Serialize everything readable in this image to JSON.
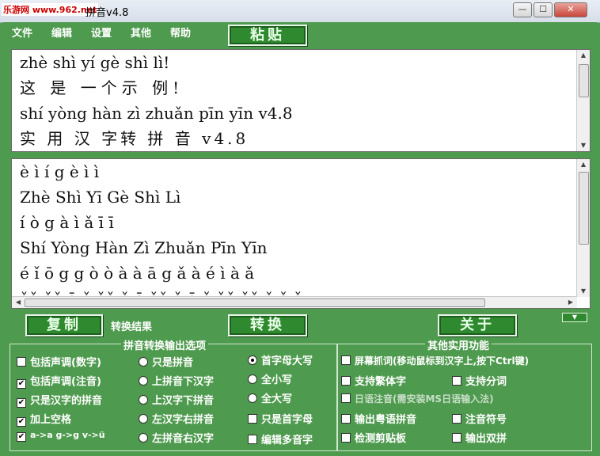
{
  "window": {
    "title": "拼音v4.8",
    "watermark": "乐游网 www.962.net",
    "minimize": "—",
    "maximize": "☐",
    "close": "✕"
  },
  "menu": [
    "文件",
    "编辑",
    "设置",
    "其他",
    "帮助"
  ],
  "buttons": {
    "paste": "粘贴",
    "copy": "复制",
    "convert": "转换",
    "about": "关于"
  },
  "source_text": [
    "zhè shì yí gè shì lì!",
    "这 是 一个示 例!",
    "shí yòng hàn zì zhuǎn pīn yīn v4.8",
    "实 用 汉 字转 拼 音 v4.8"
  ],
  "result_text": [
    "è ì í g è ì ì",
    "Zhè Shì Yī Gè Shì Lì",
    "í ò g à ì ǎ ī ī",
    "Shí Yòng Hàn Zì Zhuǎn Pīn Yīn",
    "é ǐ ō g g ò ò à à ā g ǎ à é ì à ǎ",
    "ǎǎ ǎǎ ā ǎ ǎǎ ǎ ā ǎǎ ǎ ā ǎ ǎǎ ǎǎ ǎ ǎ ǎ"
  ],
  "result_label": "转换结果",
  "pinyin_options": {
    "title": "拼音转换输出选项",
    "col1": [
      {
        "label": "包括声调(数字)",
        "checked": false
      },
      {
        "label": "包括声调(注音)",
        "checked": true
      },
      {
        "label": "只是汉字的拼音",
        "checked": true
      },
      {
        "label": "加上空格",
        "checked": true
      },
      {
        "label": "a->a g->g v->ü",
        "checked": true
      }
    ],
    "col2": [
      {
        "label": "只是拼音",
        "selected": false
      },
      {
        "label": "上拼音下汉字",
        "selected": false
      },
      {
        "label": "上汉字下拼音",
        "selected": false
      },
      {
        "label": "左汉字右拼音",
        "selected": false
      },
      {
        "label": "左拼音右汉字",
        "selected": false
      }
    ],
    "col3": [
      {
        "label": "首字母大写",
        "kind": "radio",
        "on": true
      },
      {
        "label": "全小写",
        "kind": "radio",
        "on": false
      },
      {
        "label": "全大写",
        "kind": "radio",
        "on": false
      },
      {
        "label": "只是首字母",
        "kind": "check",
        "on": false
      },
      {
        "label": "编辑多音字",
        "kind": "check",
        "on": false
      }
    ]
  },
  "other_features": {
    "title": "其他实用功能",
    "screen_capture": "屏幕抓词(移动鼠标到汉字上,按下Ctrl键)",
    "traditional": "支持繁体字",
    "split_word": "支持分词",
    "japanese": "日语注音(需安装MS日语输入法)",
    "cantonese": "输出粤语拼音",
    "zhuyin": "注音符号",
    "clipboard": "检测剪贴板",
    "output_bopomofo": "输出双拼"
  },
  "colors": {
    "background": "#4e9a4e",
    "button": "#2f8a2f"
  }
}
